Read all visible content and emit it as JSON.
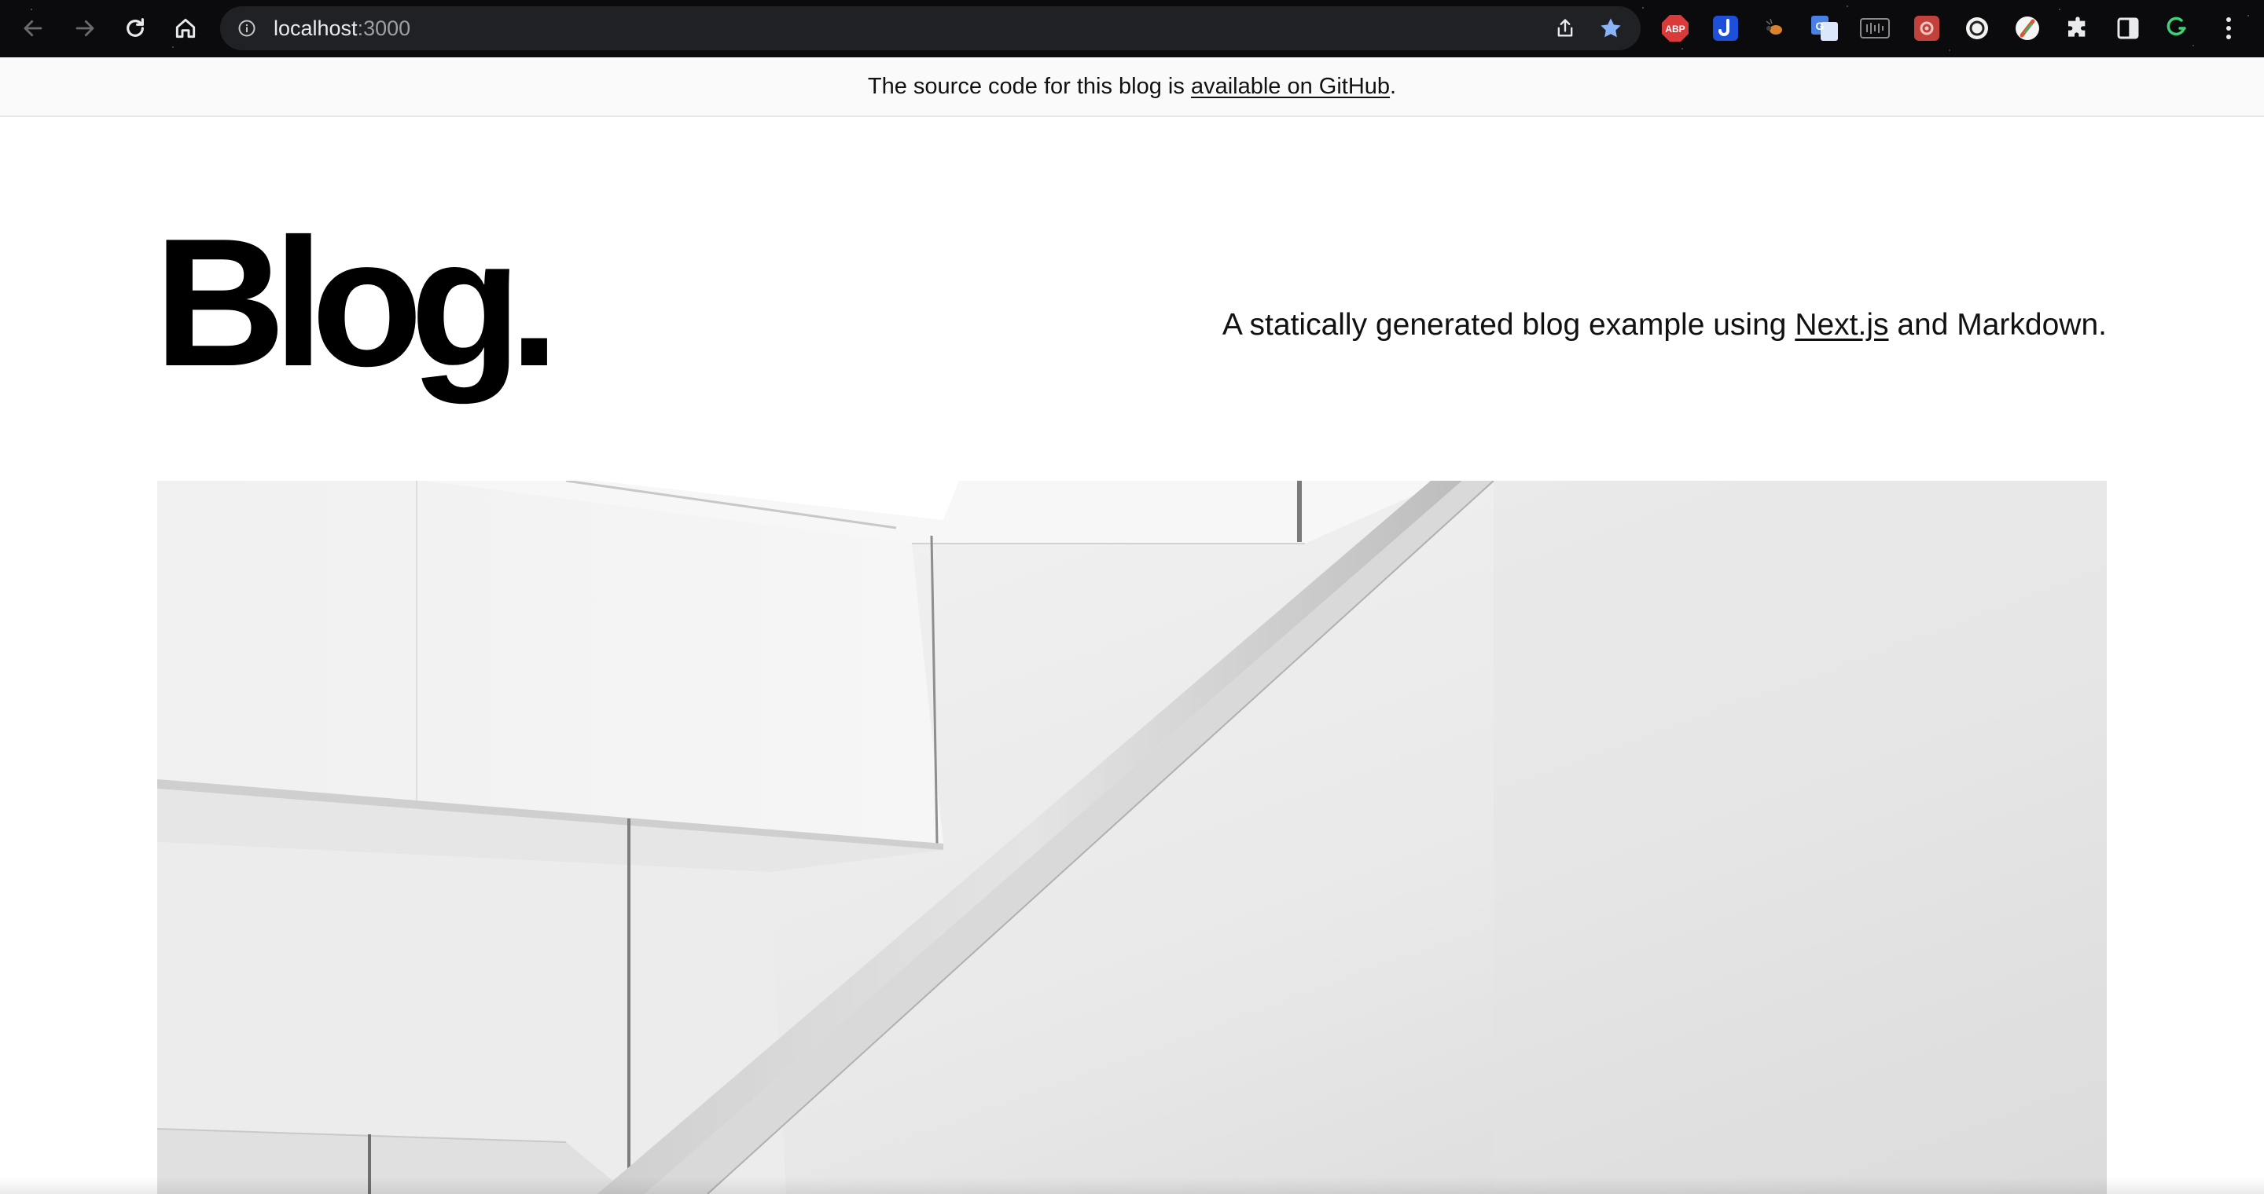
{
  "browser": {
    "url_host": "localhost",
    "url_port": ":3000",
    "extension_icons": [
      "adblock-plus-icon",
      "jira-icon",
      "bug-icon",
      "translate-icon",
      "screen-reader-icon",
      "screencast-icon",
      "circle-icon",
      "color-picker-icon",
      "puzzle-extensions-icon",
      "side-panel-icon",
      "grammar-icon",
      "kebab-menu-icon"
    ],
    "abp_label": "ABP"
  },
  "notice": {
    "prefix": "The source code for this blog is ",
    "link": "available on GitHub",
    "suffix": "."
  },
  "header": {
    "title": "Blog.",
    "tagline_prefix": "A statically generated blog example using ",
    "tagline_link": "Next.js",
    "tagline_suffix": " and Markdown."
  },
  "colors": {
    "toolbar_bg": "#0b0b0d",
    "omnibox_bg": "#202124",
    "star": "#8ab4f8",
    "notice_bg": "#fafafa"
  }
}
